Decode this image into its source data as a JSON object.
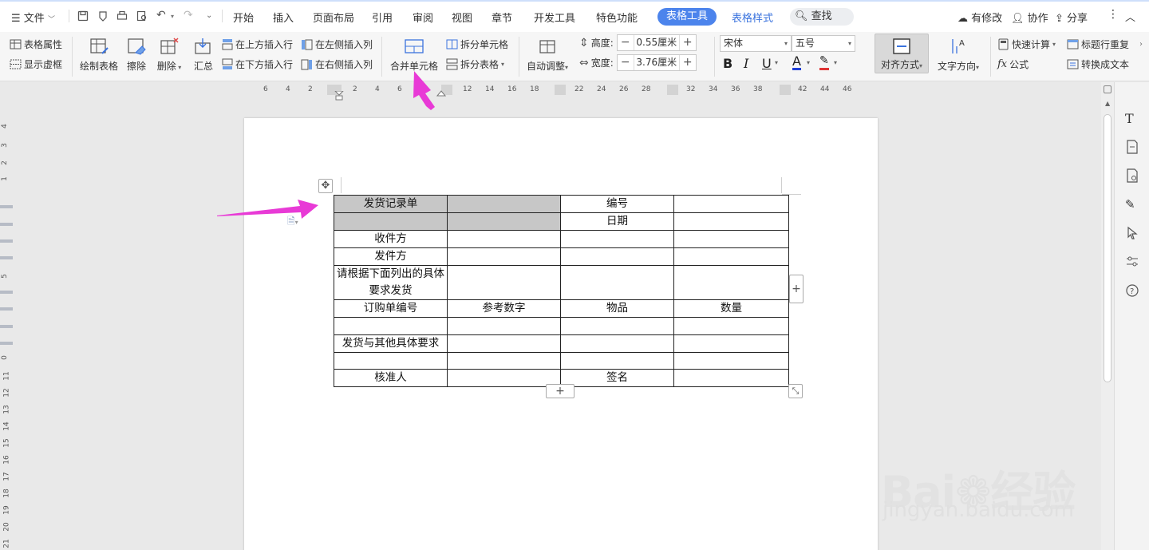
{
  "menu": {
    "file": "文件",
    "tabs": [
      "开始",
      "插入",
      "页面布局",
      "引用",
      "审阅",
      "视图",
      "章节",
      "开发工具",
      "特色功能"
    ],
    "active_tab": "表格工具",
    "tab_style": "表格样式",
    "search": "查找",
    "right": {
      "modified": "有修改",
      "collab": "协作",
      "share": "分享"
    }
  },
  "ribbon": {
    "table_props": "表格属性",
    "show_grid": "显示虚框",
    "draw_table": "绘制表格",
    "erase": "擦除",
    "delete": "删除",
    "summary": "汇总",
    "insert_above": "在上方插入行",
    "insert_below": "在下方插入行",
    "insert_left": "在左侧插入列",
    "insert_right": "在右侧插入列",
    "merge_cells": "合并单元格",
    "split_cells": "拆分单元格",
    "split_table": "拆分表格",
    "auto_adjust": "自动调整",
    "height_label": "高度:",
    "height_value": "0.55厘米",
    "width_label": "宽度:",
    "width_value": "3.76厘米",
    "font_name": "宋体",
    "font_size": "五号",
    "align": "对齐方式",
    "text_dir": "文字方向",
    "quick_calc": "快速计算",
    "repeat_header": "标题行重复",
    "formula": "公式",
    "to_text": "转换成文本",
    "bold": "B",
    "italic": "I",
    "underline": "U",
    "font_color": "A"
  },
  "hruler": [
    "6",
    "4",
    "2",
    "2",
    "4",
    "6",
    "12",
    "14",
    "16",
    "18",
    "22",
    "24",
    "26",
    "28",
    "32",
    "34",
    "36",
    "38",
    "42",
    "44",
    "46"
  ],
  "vruler": [
    "4",
    "3",
    "2",
    "1",
    "5",
    "0",
    "11",
    "12",
    "13",
    "14",
    "15",
    "16",
    "17",
    "18",
    "19",
    "20",
    "21"
  ],
  "table": {
    "r1c1": "发货记录单",
    "r1c3": "编号",
    "r2c3": "日期",
    "r3c1": "收件方",
    "r4c1": "发件方",
    "r5c1": "请根据下面列出的具体要求发货",
    "r6c1": "订购单编号",
    "r6c2": "参考数字",
    "r6c3": "物品",
    "r6c4": "数量",
    "r8c1": "发货与其他具体要求",
    "r10c1": "核准人",
    "r10c3": "签名"
  },
  "watermark": {
    "brand": "Bai",
    "cn": "经验",
    "site": "jingyan.baidu.com"
  },
  "colors": {
    "accent": "#4c84ec",
    "arrow": "#e83ad6",
    "selection": "#c7c7c7"
  }
}
